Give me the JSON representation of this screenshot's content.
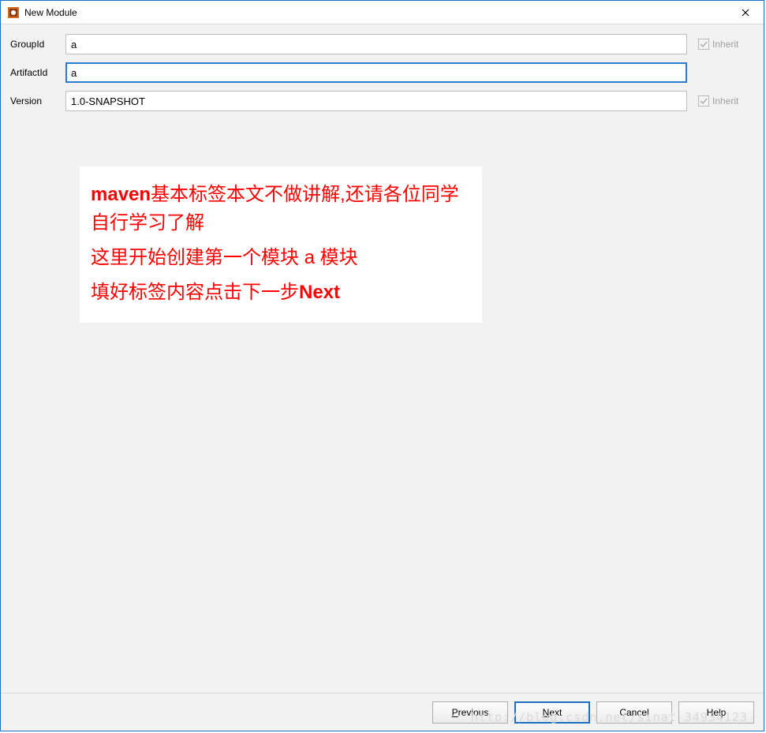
{
  "window": {
    "title": "New Module"
  },
  "form": {
    "groupId": {
      "label": "GroupId",
      "value": "a",
      "inherit": "Inherit"
    },
    "artifactId": {
      "label": "ArtifactId",
      "value": "a"
    },
    "version": {
      "label": "Version",
      "value": "1.0-SNAPSHOT",
      "inherit": "Inherit"
    }
  },
  "annotation": {
    "p1a": "maven",
    "p1b": "基本标签本文不做讲解,还请各位同学自行学习了解",
    "p2": "这里开始创建第一个模块 a 模块",
    "p3a": "填好标签内容点击下一步",
    "p3b": "Next"
  },
  "buttons": {
    "previous": "Previous",
    "next": "Next",
    "cancel": "Cancel",
    "help": "Help"
  },
  "watermark": "http://blog.csdn.net/sinat 34934123"
}
